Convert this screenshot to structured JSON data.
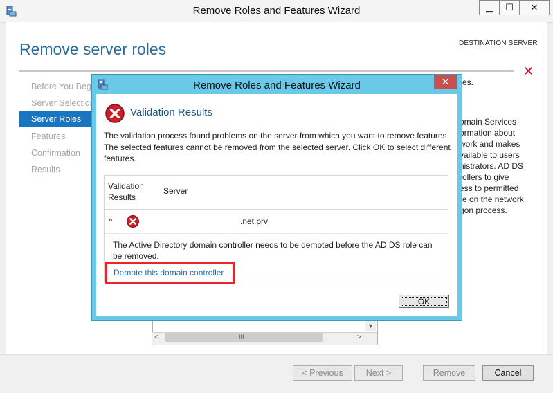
{
  "window": {
    "title": "Remove Roles and Features Wizard",
    "minimize": "▁",
    "maximize": "☐",
    "close": "✕"
  },
  "page": {
    "heading": "Remove server roles",
    "destination_label": "DESTINATION SERVER",
    "close_mark": "✕"
  },
  "nav": {
    "items": [
      {
        "label": "Before You Begin"
      },
      {
        "label": "Server Selection"
      },
      {
        "label": "Server Roles"
      },
      {
        "label": "Features"
      },
      {
        "label": "Confirmation"
      },
      {
        "label": "Results"
      }
    ],
    "selected_index": 2
  },
  "description_fragments": [
    "es.",
    "omain Services",
    "ormation about",
    "work and makes",
    "vailable to users",
    "nistrators. AD DS",
    "rollers to give",
    "ess to permitted",
    "re on the network",
    "gon process."
  ],
  "footer": {
    "previous": "< Previous",
    "next": "Next >",
    "remove": "Remove",
    "cancel": "Cancel"
  },
  "dialog": {
    "title": "Remove Roles and Features Wizard",
    "close": "✕",
    "heading": "Validation Results",
    "description": "The validation process found problems on the server from which you want to remove features. The selected features cannot be removed from the selected server.  Click OK to select different features.",
    "columns": {
      "validation": "Validation Results",
      "server": "Server"
    },
    "row": {
      "chevron": "^",
      "server": ".net.prv",
      "message": "The Active Directory domain controller needs to be demoted before the AD DS role can be removed.",
      "link": "Demote this domain controller"
    },
    "ok": "OK"
  },
  "colors": {
    "accent": "#1a75c1",
    "heading": "#2b6c9a",
    "dialog_frame": "#6ac8e8",
    "error": "#c81f2a",
    "highlight_box": "#e8232b"
  }
}
